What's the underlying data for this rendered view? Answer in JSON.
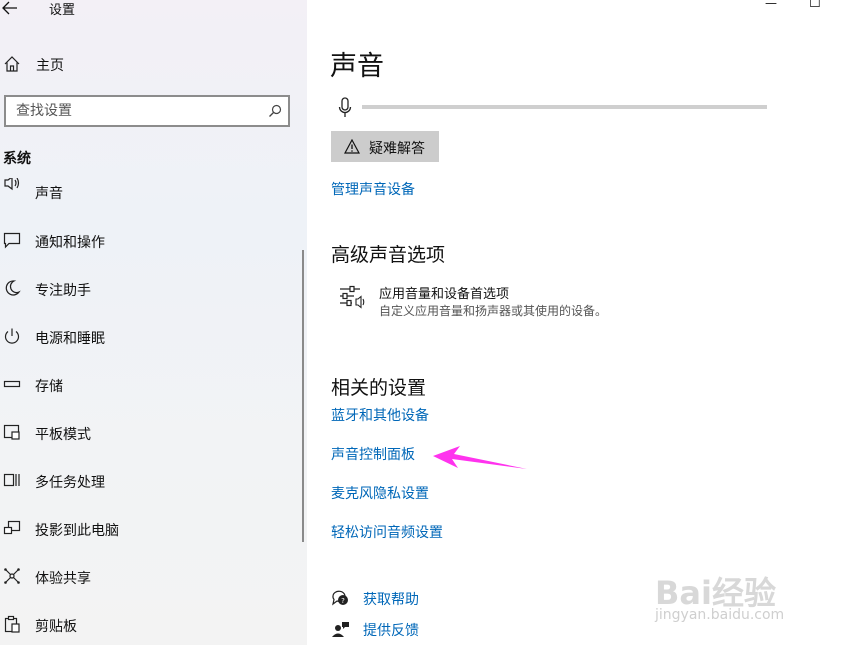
{
  "window": {
    "title": "设置",
    "controls": {
      "minimize": "—",
      "maximize": "☐"
    }
  },
  "sidebar": {
    "home_label": "主页",
    "search_placeholder": "查找设置",
    "section_title": "系统",
    "items": [
      {
        "label": "声音",
        "icon": "sound-icon"
      },
      {
        "label": "通知和操作",
        "icon": "notification-icon"
      },
      {
        "label": "专注助手",
        "icon": "moon-icon"
      },
      {
        "label": "电源和睡眠",
        "icon": "power-icon"
      },
      {
        "label": "存储",
        "icon": "storage-icon"
      },
      {
        "label": "平板模式",
        "icon": "tablet-icon"
      },
      {
        "label": "多任务处理",
        "icon": "multitask-icon"
      },
      {
        "label": "投影到此电脑",
        "icon": "project-icon"
      },
      {
        "label": "体验共享",
        "icon": "share-icon"
      },
      {
        "label": "剪贴板",
        "icon": "clipboard-icon"
      }
    ]
  },
  "main": {
    "page_title": "声音",
    "troubleshoot_label": "疑难解答",
    "manage_devices_link": "管理声音设备",
    "advanced": {
      "heading": "高级声音选项",
      "app_volume_title": "应用音量和设备首选项",
      "app_volume_desc": "自定义应用音量和扬声器或其使用的设备。"
    },
    "related": {
      "heading": "相关的设置",
      "links": [
        "蓝牙和其他设备",
        "声音控制面板",
        "麦克风隐私设置",
        "轻松访问音频设置"
      ]
    },
    "help": {
      "get_help": "获取帮助",
      "feedback": "提供反馈"
    }
  },
  "watermark": {
    "brand": "Bai经验",
    "url": "jingyan.baidu.com"
  },
  "colors": {
    "link": "#0067b8",
    "annotation_arrow": "#ff33ee"
  }
}
